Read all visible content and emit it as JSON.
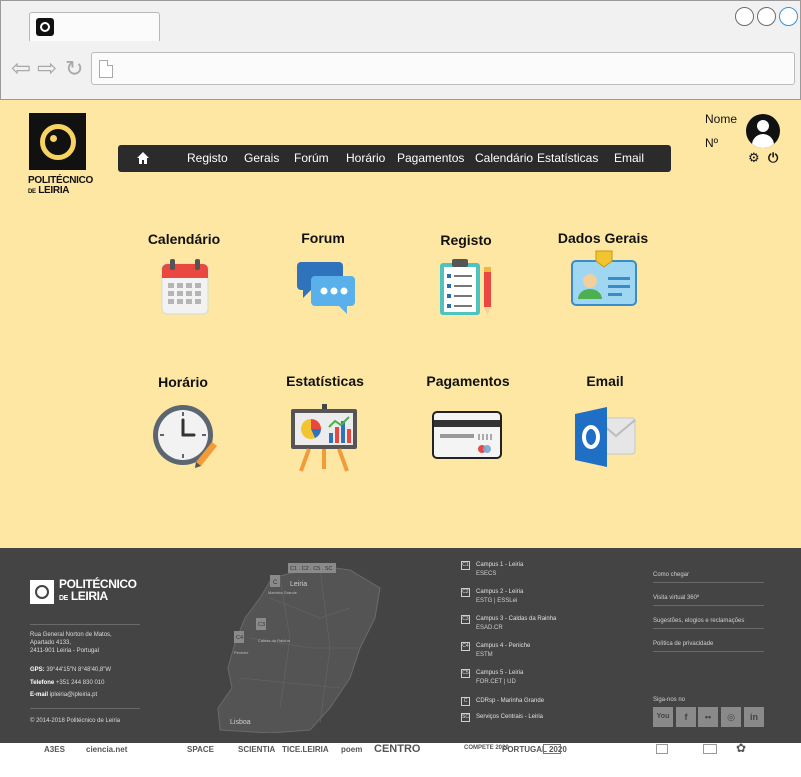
{
  "header": {
    "nav": [
      {
        "label": "Registo"
      },
      {
        "label": "Gerais"
      },
      {
        "label": "Forúm"
      },
      {
        "label": "Horário"
      },
      {
        "label": "Pagamentos"
      },
      {
        "label": "Calendário"
      },
      {
        "label": "Estatísticas"
      },
      {
        "label": "Email"
      }
    ],
    "logo": {
      "line1": "POLITÉCNICO",
      "prefix": "DE",
      "line2": "LEIRIA"
    },
    "user": {
      "name_label": "Nome",
      "number_label": "Nº"
    }
  },
  "tiles": [
    {
      "label": "Calendário",
      "icon": "calendar-icon"
    },
    {
      "label": "Forum",
      "icon": "chat-bubbles-icon"
    },
    {
      "label": "Registo",
      "icon": "clipboard-icon"
    },
    {
      "label": "Dados Gerais",
      "icon": "id-card-icon"
    },
    {
      "label": "Horário",
      "icon": "clock-icon"
    },
    {
      "label": "Estatísticas",
      "icon": "presentation-chart-icon"
    },
    {
      "label": "Pagamentos",
      "icon": "credit-card-icon"
    },
    {
      "label": "Email",
      "icon": "outlook-icon"
    }
  ],
  "footer": {
    "logo": {
      "line1": "POLITÉCNICO",
      "prefix": "DE",
      "line2": "LEIRIA"
    },
    "address": [
      "Rua General Norton de Matos,",
      "Apartado 4133,",
      "2411-901 Leiria - Portugal"
    ],
    "gps_label": "GPS:",
    "gps_value": "39°44'15\"N 8°48'40,8\"W",
    "phone_label": "Telefone",
    "phone_value": "+351 244 830 010",
    "email_label": "E-mail",
    "email_value": "ipleiria@ipleiria.pt",
    "copyright": "© 2014-2018 Politécnico de Leiria",
    "map": {
      "markers": [
        "C",
        "C1 . C2 . C5 . SC",
        "C3",
        "C4"
      ],
      "places": [
        "Leiria",
        "Lisboa",
        "Peniche",
        "Caldas da Rainha",
        "Marinha Grande"
      ]
    },
    "campuses": [
      {
        "id": "C1",
        "name": "Campus 1 - Leiria",
        "sub": "ESECS"
      },
      {
        "id": "C2",
        "name": "Campus 2 - Leiria",
        "sub": "ESTG | ESSLei"
      },
      {
        "id": "C3",
        "name": "Campus 3 - Caldas da Rainha",
        "sub": "ESAD.CR"
      },
      {
        "id": "C4",
        "name": "Campus 4 - Peniche",
        "sub": "ESTM"
      },
      {
        "id": "C5",
        "name": "Campus 5 - Leiria",
        "sub": "FOR.CET | UD"
      },
      {
        "id": "C",
        "name": "CDRsp - Marinha Grande",
        "sub": ""
      },
      {
        "id": "SC",
        "name": "Serviços Centrais - Leiria",
        "sub": ""
      }
    ],
    "links": [
      "Como chegar",
      "Visita virtual 360º",
      "Sugestões, elogios e reclamações",
      "Política de privacidade"
    ],
    "follow_label": "Siga-nos no",
    "social": [
      {
        "label": "You",
        "icon": "youtube-icon"
      },
      {
        "label": "f",
        "icon": "facebook-icon"
      },
      {
        "label": "••",
        "icon": "flickr-icon"
      },
      {
        "label": "◎",
        "icon": "instagram-icon"
      },
      {
        "label": "in",
        "icon": "linkedin-icon"
      }
    ]
  },
  "sponsors": [
    "A3ES",
    "ciencia.net",
    "SPACE",
    "SCIENTIA",
    "TICE.LEIRIA",
    "poem",
    "CENTRO",
    "COMPETE 2020",
    "PORTUGAL 2020"
  ]
}
